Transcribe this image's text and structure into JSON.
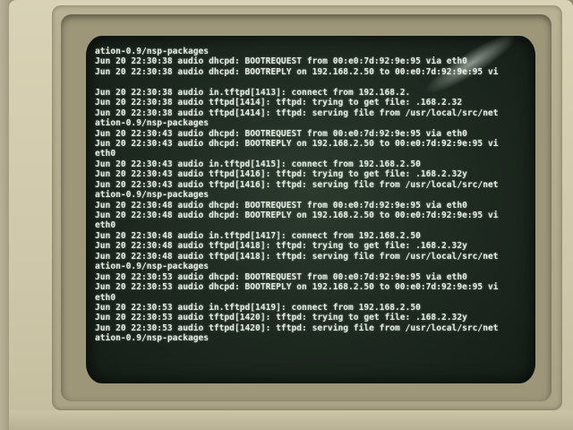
{
  "terminal": {
    "lines": [
      "ation-0.9/nsp-packages",
      "Jun 20 22:30:38 audio dhcpd: BOOTREQUEST from 00:e0:7d:92:9e:95 via eth0",
      "Jun 20 22:30:38 audio dhcpd: BOOTREPLY on 192.168.2.50 to 00:e0:7d:92:9e:95 vi",
      "",
      "Jun 20 22:30:38 audio in.tftpd[1413]: connect from 192.168.2.",
      "Jun 20 22:30:38 audio tftpd[1414]: tftpd: trying to get file: .168.2.32",
      "Jun 20 22:30:38 audio tftpd[1414]: tftpd: serving file from /usr/local/src/net",
      "ation-0.9/nsp-packages",
      "Jun 20 22:30:43 audio dhcpd: BOOTREQUEST from 00:e0:7d:92:9e:95 via eth0",
      "Jun 20 22:30:43 audio dhcpd: BOOTREPLY on 192.168.2.50 to 00:e0:7d:92:9e:95 vi",
      "eth0",
      "Jun 20 22:30:43 audio in.tftpd[1415]: connect from 192.168.2.50",
      "Jun 20 22:30:43 audio tftpd[1416]: tftpd: trying to get file: .168.2.32y",
      "Jun 20 22:30:43 audio tftpd[1416]: tftpd: serving file from /usr/local/src/net",
      "ation-0.9/nsp-packages",
      "Jun 20 22:30:48 audio dhcpd: BOOTREQUEST from 00:e0:7d:92:9e:95 via eth0",
      "Jun 20 22:30:48 audio dhcpd: BOOTREPLY on 192.168.2.50 to 00:e0:7d:92:9e:95 vi",
      "eth0",
      "Jun 20 22:30:48 audio in.tftpd[1417]: connect from 192.168.2.50",
      "Jun 20 22:30:48 audio tftpd[1418]: tftpd: trying to get file: .168.2.32y",
      "Jun 20 22:30:48 audio tftpd[1418]: tftpd: serving file from /usr/local/src/net",
      "ation-0.9/nsp-packages",
      "Jun 20 22:30:53 audio dhcpd: BOOTREQUEST from 00:e0:7d:92:9e:95 via eth0",
      "Jun 20 22:30:53 audio dhcpd: BOOTREPLY on 192.168.2.50 to 00:e0:7d:92:9e:95 vi",
      "eth0",
      "Jun 20 22:30:53 audio in.tftpd[1419]: connect from 192.168.2.50",
      "Jun 20 22:30:53 audio tftpd[1420]: tftpd: trying to get file: .168.2.32y",
      "Jun 20 22:30:53 audio tftpd[1420]: tftpd: serving file from /usr/local/src/net",
      "ation-0.9/nsp-packages"
    ]
  }
}
